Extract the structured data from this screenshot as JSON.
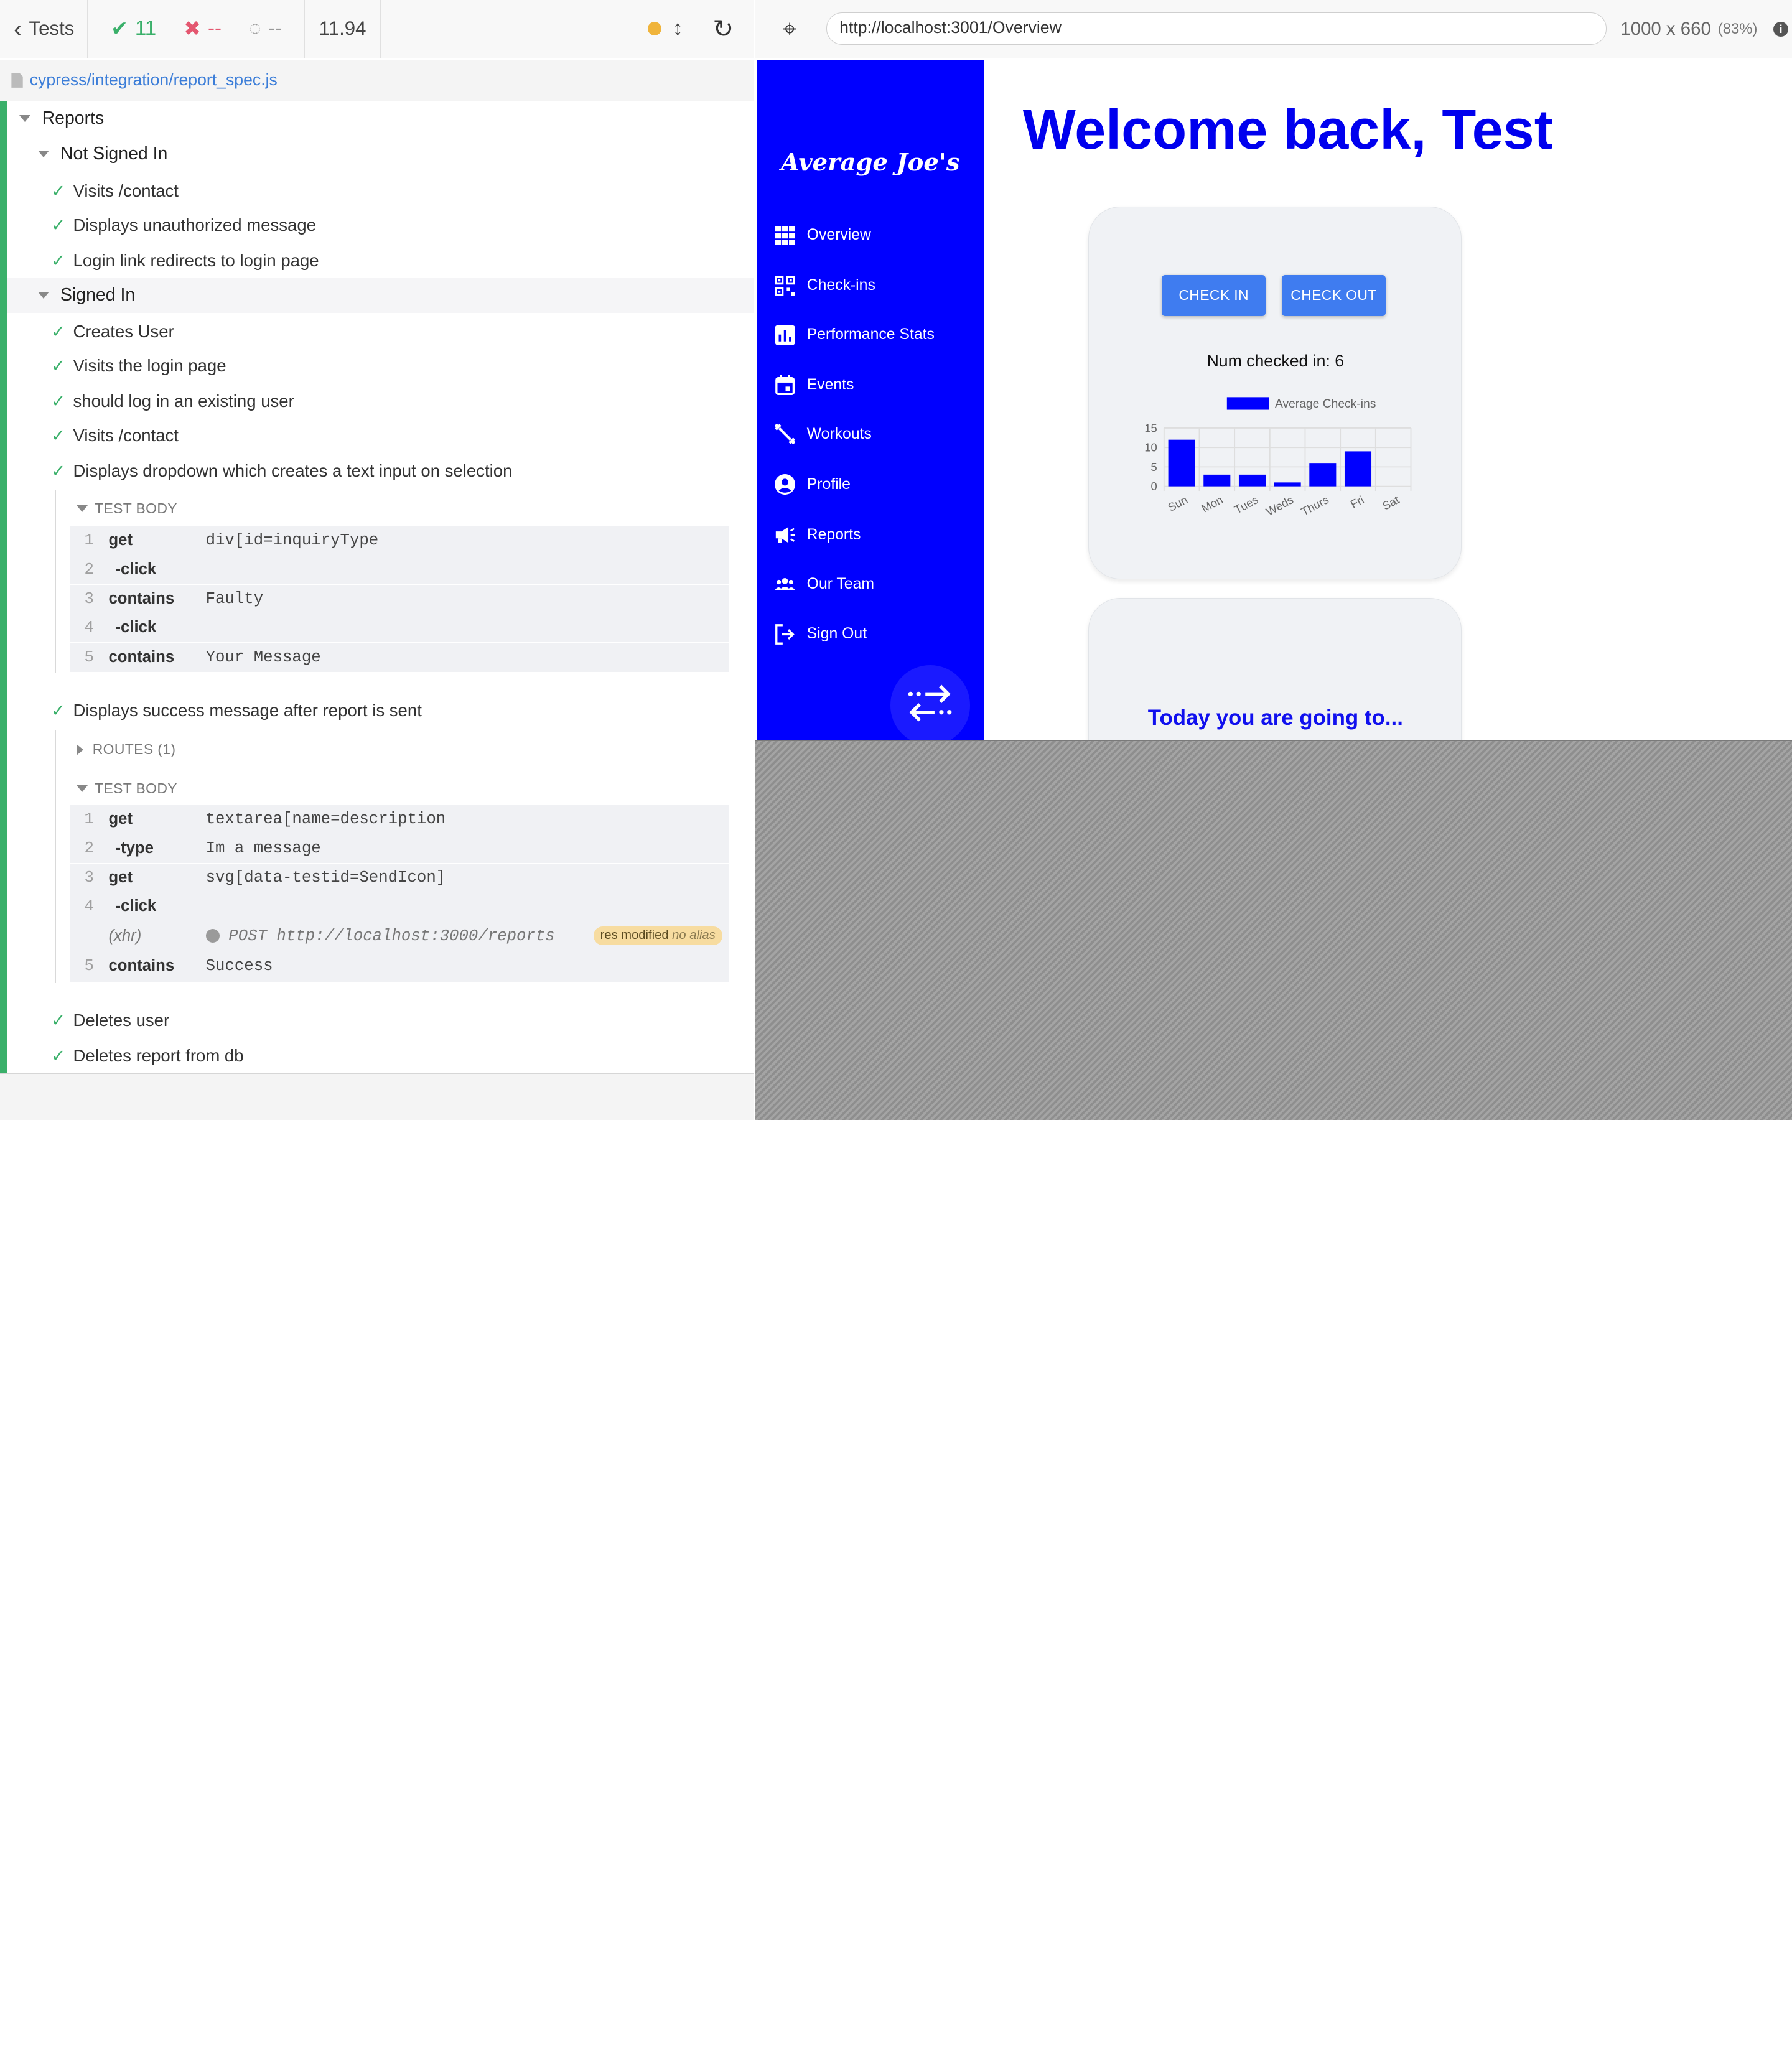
{
  "reporter": {
    "tests_label": "Tests",
    "passed": "11",
    "failed": "--",
    "pending": "--",
    "duration": "11.94",
    "spec_path": "cypress/integration/report_spec.js",
    "suite_root": "Reports",
    "suite_not_signed_in": "Not Signed In",
    "suite_signed_in": "Signed In",
    "tests": {
      "t1": "Visits /contact",
      "t2": "Displays unauthorized message",
      "t3": "Login link redirects to login page",
      "t4": "Creates User",
      "t5": "Visits the login page",
      "t6": "should log in an existing user",
      "t7": "Visits /contact",
      "t8": "Displays dropdown which creates a text input on selection",
      "t9": "Displays success message after report is sent",
      "t10": "Deletes user",
      "t11": "Deletes report from db"
    },
    "test_body_label": "TEST BODY",
    "routes_label": "ROUTES (1)",
    "block1": [
      {
        "num": "1",
        "name": "get",
        "msg": "div[id=inquiryType"
      },
      {
        "num": "2",
        "name": "-click",
        "msg": ""
      },
      {
        "num": "3",
        "name": "contains",
        "msg": "Faulty"
      },
      {
        "num": "4",
        "name": "-click",
        "msg": ""
      },
      {
        "num": "5",
        "name": "contains",
        "msg": "Your Message"
      }
    ],
    "block2": [
      {
        "num": "1",
        "name": "get",
        "msg": "textarea[name=description"
      },
      {
        "num": "2",
        "name": "-type",
        "msg": "Im a message"
      },
      {
        "num": "3",
        "name": "get",
        "msg": "svg[data-testid=SendIcon]"
      },
      {
        "num": "4",
        "name": "-click",
        "msg": ""
      },
      {
        "num": "",
        "name": "(xhr)",
        "msg": "POST http://localhost:3000/reports"
      },
      {
        "num": "5",
        "name": "contains",
        "msg": "Success"
      }
    ],
    "badge_main": "res modified",
    "badge_alias": "no alias"
  },
  "browser": {
    "url": "http://localhost:3001/Overview",
    "viewport": "1000 x 660",
    "zoom": "(83%)"
  },
  "app": {
    "brand": "Average Joe's",
    "nav": [
      "Overview",
      "Check-ins",
      "Performance Stats",
      "Events",
      "Workouts",
      "Profile",
      "Reports",
      "Our Team",
      "Sign Out"
    ],
    "welcome": "Welcome back, Test",
    "check_in": "CHECK IN",
    "check_out": "CHECK OUT",
    "num_checked": "Num checked in: 6",
    "today": "Today you are going to..."
  },
  "colors": {
    "sidebar": "#0000ff",
    "accent": "#3f7cf0",
    "pass": "#3ab06a",
    "welcome": "#0000ee"
  },
  "chart_data": {
    "type": "bar",
    "categories": [
      "Sun",
      "Mon",
      "Tues",
      "Weds",
      "Thurs",
      "Fri",
      "Sat"
    ],
    "series": [
      {
        "name": "Average Check-ins",
        "values": [
          12,
          3,
          3,
          1,
          6,
          9,
          0
        ]
      }
    ],
    "yticks": [
      "15",
      "10",
      "5",
      "0"
    ],
    "ylim": [
      0,
      15
    ],
    "grid": true,
    "legend": "top"
  }
}
